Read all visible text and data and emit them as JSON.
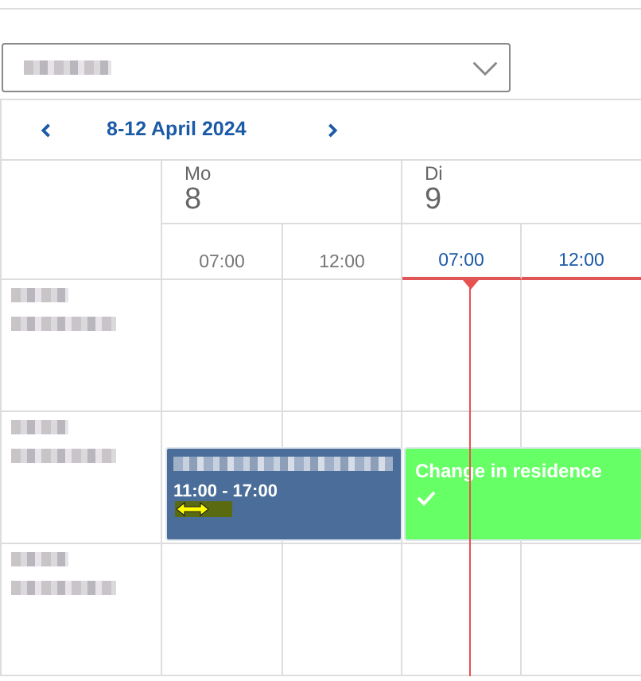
{
  "selector": {
    "blurred": true
  },
  "navigation": {
    "title": "8-12 April 2024"
  },
  "days": [
    {
      "weekday": "Mo",
      "date": "8",
      "today": false,
      "hours": [
        "07:00",
        "12:00"
      ]
    },
    {
      "weekday": "Di",
      "date": "9",
      "today": true,
      "hours": [
        "07:00",
        "12:00"
      ]
    }
  ],
  "resources": [
    {
      "blurred": true
    },
    {
      "blurred": true,
      "events": [
        {
          "title_blurred": true,
          "time": "11:00 - 17:00",
          "color": "#4a6e99",
          "done": false
        },
        {
          "title": "Change in residence",
          "done": true,
          "color": "#66ff66"
        }
      ]
    },
    {
      "blurred": true
    }
  ]
}
